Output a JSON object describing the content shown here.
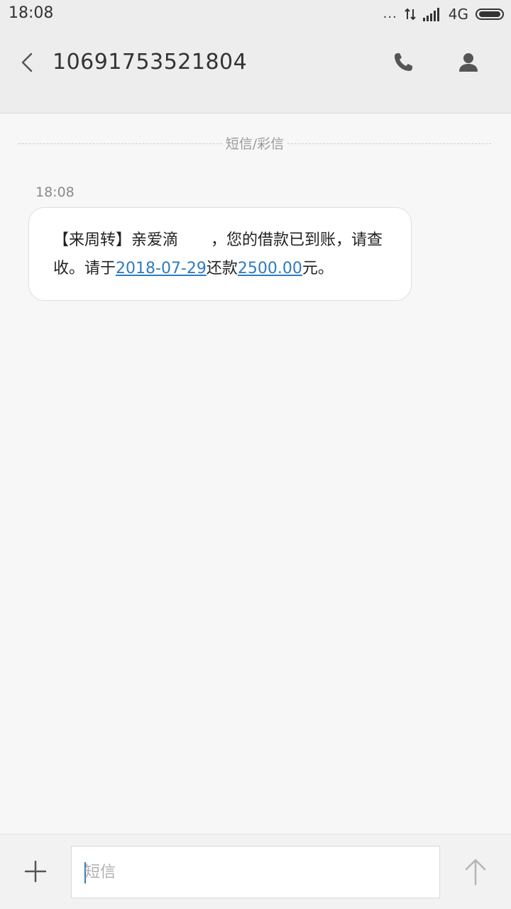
{
  "status_bar": {
    "time": "18:08",
    "dots": "...",
    "network": "4G"
  },
  "header": {
    "title": "10691753521804"
  },
  "thread": {
    "divider_label": "短信/彩信",
    "message": {
      "time": "18:08",
      "text_part1": "【来周转】亲爱滴",
      "text_part2": "，您的借款已到账，请查收。请于",
      "date_link": "2018-07-29",
      "text_part3": "还款",
      "amount_link": "2500.00",
      "text_part4": "元。"
    }
  },
  "composer": {
    "placeholder": "短信"
  },
  "colors": {
    "link": "#2f7bbf",
    "background": "#f7f7f7",
    "header": "#ededed"
  },
  "icons": {
    "back": "chevron-left-icon",
    "call": "phone-icon",
    "contact": "person-icon",
    "add": "plus-icon",
    "send": "arrow-up-icon"
  }
}
